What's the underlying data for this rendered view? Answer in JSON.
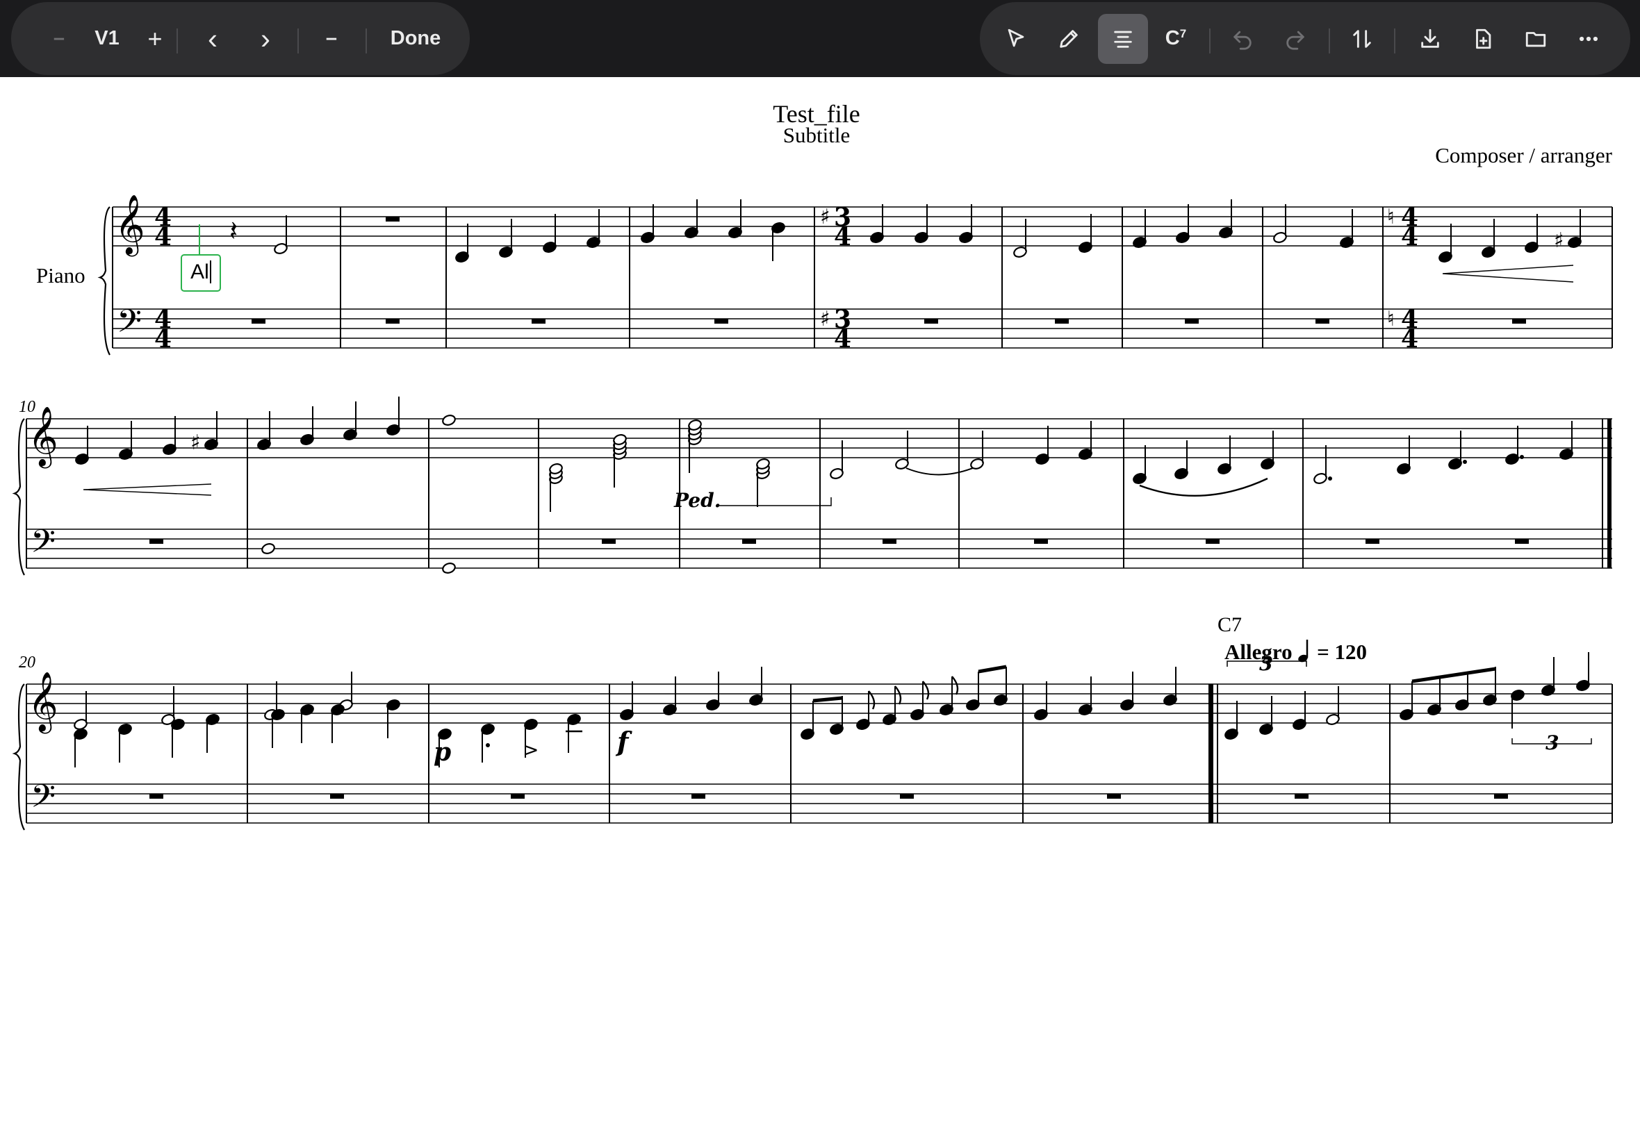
{
  "toolbar": {
    "left": {
      "minus_label": "–",
      "voice_label": "V1",
      "plus_label": "+",
      "prev_label": "‹",
      "next_label": "›",
      "dash_label": "–",
      "done_label": "Done"
    },
    "right": {
      "chord_label": "C",
      "chord_sup": "7",
      "icons": [
        "pointer-icon",
        "pencil-icon",
        "align-icon",
        "chord-symbol-icon",
        "undo-icon",
        "redo-icon",
        "sort-icon",
        "download-icon",
        "new-file-icon",
        "folder-icon",
        "more-icon"
      ]
    }
  },
  "score": {
    "title": "Test_file",
    "subtitle": "Subtitle",
    "composer": "Composer / arranger",
    "instrument": "Piano",
    "measure_numbers": [
      "10",
      "20"
    ],
    "lyric_input_value": "Al",
    "chord_symbol": "C7",
    "tempo_text": "Allegro",
    "tempo_value": "= 120",
    "tuplet_number": "3",
    "pedal_text": "Ped.",
    "dynamics": [
      "p",
      "f"
    ]
  }
}
